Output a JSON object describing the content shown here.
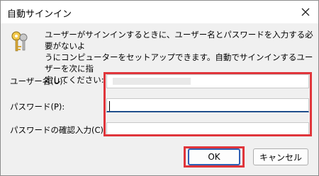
{
  "dialog": {
    "title": "自動サインイン",
    "close_icon": "close-icon",
    "key_icon": "key-icon",
    "description_line1": "ユーザーがサインインするときに、ユーザー名とパスワードを入力する必要がないよ",
    "description_line2": "うにコンピューターをセットアップできます。自動でサインインするユーザーを次に指",
    "description_line3": "定してください:",
    "username_label": "ユーザー名(U):",
    "username_value": "",
    "password_label": "パスワード(P):",
    "password_value": "",
    "confirm_label": "パスワードの確認入力(C):",
    "confirm_value": "",
    "ok_label": "OK",
    "cancel_label": "キャンセル",
    "highlight_color": "#e0353b",
    "focus_color": "#1f4e8c"
  }
}
